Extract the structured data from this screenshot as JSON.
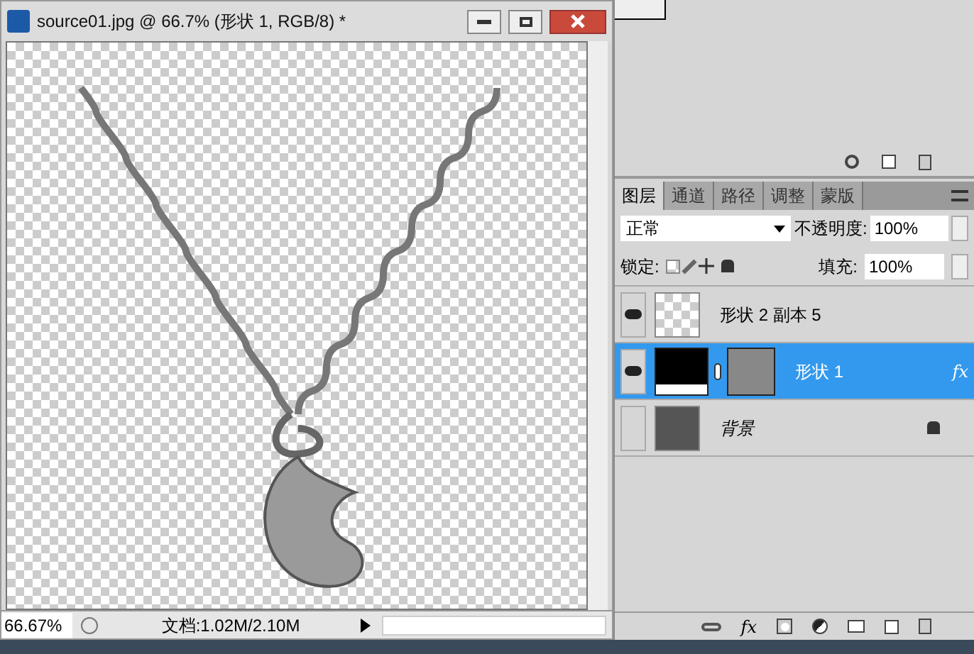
{
  "document": {
    "title": "source01.jpg @ 66.7% (形状 1, RGB/8) *",
    "zoom": "66.67%",
    "doc_info": "文档:1.02M/2.10M"
  },
  "layers_panel": {
    "tabs": [
      {
        "label": "图层",
        "selected": true
      },
      {
        "label": "通道",
        "selected": false
      },
      {
        "label": "路径",
        "selected": false
      },
      {
        "label": "调整",
        "selected": false
      },
      {
        "label": "蒙版",
        "selected": false
      }
    ],
    "blend_mode": "正常",
    "opacity_label": "不透明度:",
    "opacity": "100%",
    "lock_label": "锁定:",
    "fill_label": "填充:",
    "fill": "100%",
    "layers": [
      {
        "name": "形状 2 副本 5",
        "kind": "transparent",
        "visible": true,
        "selected": false,
        "locked": false
      },
      {
        "name": "形状 1",
        "kind": "shape",
        "visible": true,
        "selected": true,
        "locked": false,
        "effects": "fx"
      },
      {
        "name": "背景",
        "kind": "photo",
        "visible": false,
        "selected": false,
        "locked": true
      }
    ],
    "footer_effects": "fx"
  }
}
